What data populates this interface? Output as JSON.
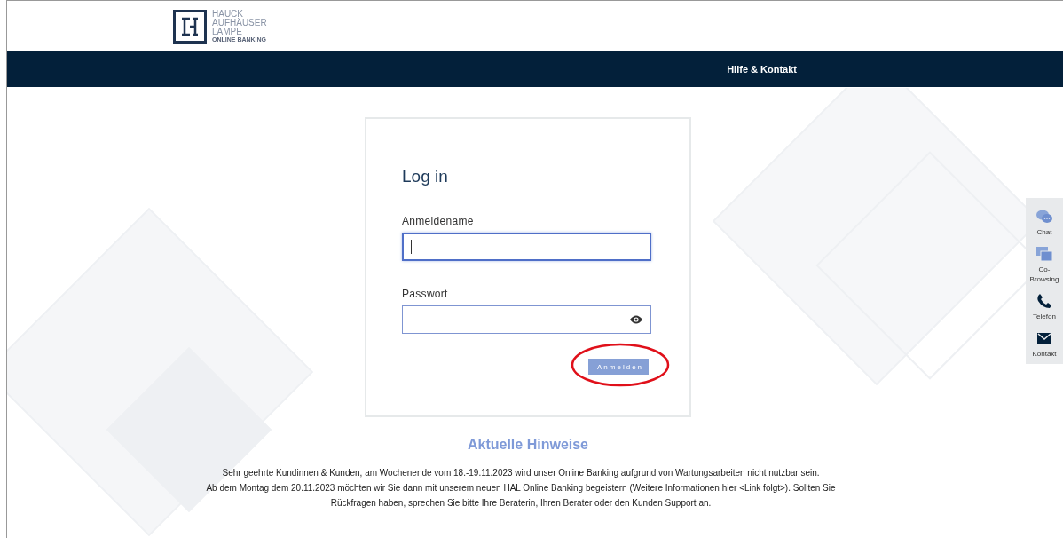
{
  "logo": {
    "lines": [
      "HAUCK",
      "AUFHÄUSER",
      "LAMPE"
    ],
    "subtitle": "ONLINE BANKING"
  },
  "nav": {
    "link": "Hilfe & Kontakt"
  },
  "login": {
    "title": "Log in",
    "fields": [
      {
        "kind": "text",
        "label": "Anmeldename",
        "focused": true
      },
      {
        "kind": "password",
        "label": "Passwort",
        "focused": false
      }
    ],
    "submit": "Anmelden"
  },
  "notice": {
    "title": "Aktuelle Hinweise",
    "paragraphs": [
      "Sehr geehrte Kundinnen & Kunden, am Wochenende vom 18.-19.11.2023 wird unser Online Banking aufgrund von Wartungsarbeiten nicht nutzbar sein.",
      "Ab dem Montag dem 20.11.2023 möchten wir Sie dann mit unserem neuen HAL Online Banking begeistern (Weitere Informationen hier <Link folgt>). Sollten Sie Rückfragen haben, sprechen Sie bitte Ihre Beraterin, Ihren Berater oder den Kunden Support an."
    ]
  },
  "side_panel": [
    {
      "kind": "chat",
      "label": "Chat"
    },
    {
      "kind": "cobrowse",
      "label": "Co-Browsing"
    },
    {
      "kind": "phone",
      "label": "Telefon"
    },
    {
      "kind": "mail",
      "label": "Kontakt"
    }
  ]
}
